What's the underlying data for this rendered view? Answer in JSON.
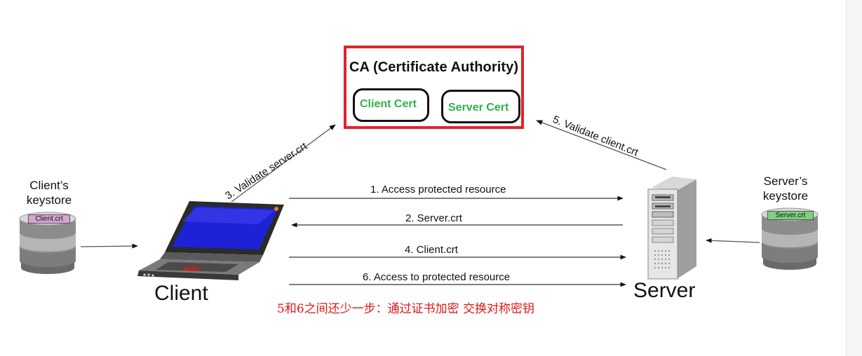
{
  "ca": {
    "title": "CA (Certificate Authority)",
    "client_cert": "Client Cert",
    "server_cert": "Server Cert"
  },
  "steps": {
    "validate_server": "3. Validate server.crt",
    "validate_client": "5. Validate client.crt",
    "access_protected": "1.  Access protected resource",
    "server_crt": "2. Server.crt",
    "client_crt": "4. Client.crt",
    "access_to_protected": "6. Access to protected resource"
  },
  "client": {
    "keystore_title_line1": "Client’s",
    "keystore_title_line2": "keystore",
    "keystore_tag": "Client.crt",
    "label": "Client"
  },
  "server": {
    "keystore_title_line1": "Server’s",
    "keystore_title_line2": "keystore",
    "keystore_tag": "Server.crt",
    "label": "Server"
  },
  "note": "5和6之间还少一步：通过证书加密 交换对称密钥",
  "colors": {
    "ca_border": "#e0232b",
    "cert_text": "#2db34a",
    "note": "#e01818",
    "client_tag": "#d9a3cf",
    "server_tag": "#7ed27e",
    "laptop_screen": "#1e22d6"
  },
  "icons": [
    "database-icon",
    "laptop-icon",
    "server-tower-icon"
  ]
}
